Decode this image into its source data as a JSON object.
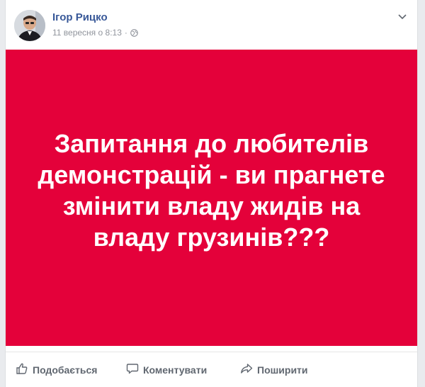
{
  "post": {
    "author": "Ігор Рицко",
    "date": "11 вересня о 8:13",
    "separator": "·",
    "banner_text": "Запитання до любителів демонстрацій - ви прагнете змінити владу жидів на владу грузинів???"
  },
  "actions": {
    "like": "Подобається",
    "comment": "Коментувати",
    "share": "Поширити"
  },
  "icons": [
    "avatar",
    "globe-icon",
    "chevron-down-icon",
    "thumbs-up-icon",
    "comment-icon",
    "share-icon"
  ],
  "colors": {
    "banner": "#e4013a",
    "author": "#385898",
    "meta": "#90949c",
    "action": "#606770"
  }
}
